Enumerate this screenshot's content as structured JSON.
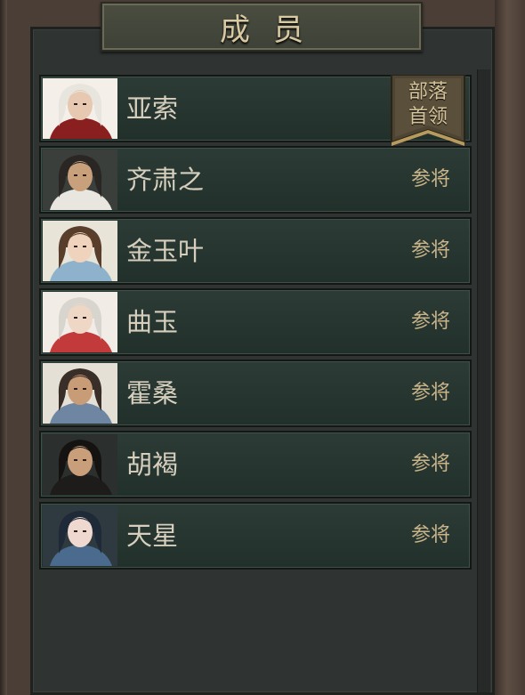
{
  "header": {
    "title": "成员"
  },
  "members": [
    {
      "name": "亚索",
      "role": "部落首领",
      "role_line1": "部落",
      "role_line2": "首领",
      "is_leader": true,
      "avatar": {
        "hair": "#e8e4de",
        "skin": "#e6c9b0",
        "cloth": "#8a1f1f",
        "bg": "#f4efe8"
      }
    },
    {
      "name": "齐肃之",
      "role": "参将",
      "is_leader": false,
      "avatar": {
        "hair": "#2a2623",
        "skin": "#c9a07c",
        "cloth": "#e9e6e0",
        "bg": "#3a3f3c"
      }
    },
    {
      "name": "金玉叶",
      "role": "参将",
      "is_leader": false,
      "avatar": {
        "hair": "#5a3e2c",
        "skin": "#f0d3bd",
        "cloth": "#8fb2cc",
        "bg": "#e8e4d8"
      }
    },
    {
      "name": "曲玉",
      "role": "参将",
      "is_leader": false,
      "avatar": {
        "hair": "#d8d4ce",
        "skin": "#efd7c6",
        "cloth": "#c23a3a",
        "bg": "#f2ece6"
      }
    },
    {
      "name": "霍桑",
      "role": "参将",
      "is_leader": false,
      "avatar": {
        "hair": "#3a2f28",
        "skin": "#c99c78",
        "cloth": "#6f86a3",
        "bg": "#e4e0d6"
      }
    },
    {
      "name": "胡褐",
      "role": "参将",
      "is_leader": false,
      "avatar": {
        "hair": "#151312",
        "skin": "#c99e7a",
        "cloth": "#1e1c1a",
        "bg": "#2b302e"
      }
    },
    {
      "name": "天星",
      "role": "参将",
      "is_leader": false,
      "avatar": {
        "hair": "#1f2a38",
        "skin": "#eed8cf",
        "cloth": "#4a6a8e",
        "bg": "#2f3a40"
      }
    }
  ]
}
